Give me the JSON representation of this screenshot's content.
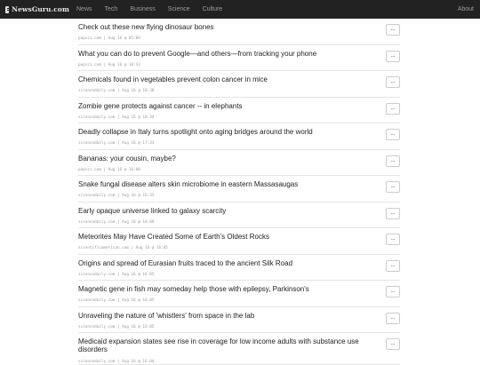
{
  "navbar": {
    "brand": "NewsGuru.com",
    "links": [
      "News",
      "Tech",
      "Business",
      "Science",
      "Culture"
    ],
    "about": "About"
  },
  "items": [
    {
      "title": "Check out these new flying dinosaur bones",
      "meta": "popsci.com | Aug 16 @ 05:06",
      "action": "..."
    },
    {
      "title": "What you can do to prevent Google—and others—from tracking your phone",
      "meta": "popsci.com | Aug 16 @ 18:43",
      "action": "..."
    },
    {
      "title": "Chemicals found in vegetables prevent colon cancer in mice",
      "meta": "sciencedaily.com | Aug 16 @ 18:38",
      "action": "..."
    },
    {
      "title": "Zombie gene protects against cancer -- in elephants",
      "meta": "sciencedaily.com | Aug 16 @ 18:34",
      "action": "..."
    },
    {
      "title": "Deadly collapse in Italy turns spotlight onto aging bridges around the world",
      "meta": "sciencedaily.com | Aug 16 @ 17:33",
      "action": "..."
    },
    {
      "title": "Bananas: your cousin, maybe?",
      "meta": "popsci.com | Aug 16 @ 16:08",
      "action": "..."
    },
    {
      "title": "Snake fungal disease alters skin microbiome in eastern Massasaugas",
      "meta": "sciencedaily.com | Aug 16 @ 16:33",
      "action": "..."
    },
    {
      "title": "Early opaque universe linked to galaxy scarcity",
      "meta": "sciencedaily.com | Aug 16 @ 16:09",
      "action": "..."
    },
    {
      "title": "Meteorites May Have Created Some of Earth's Oldest Rocks",
      "meta": "scientificamerican.com | Aug 16 @ 16:05",
      "action": "..."
    },
    {
      "title": "Origins and spread of Eurasian fruits traced to the ancient Silk Road",
      "meta": "sciencedaily.com | Aug 16 @ 16:05",
      "action": "..."
    },
    {
      "title": "Magnetic gene in fish may someday help those with epilepsy, Parkinson's",
      "meta": "sciencedaily.com | Aug 16 @ 16:05",
      "action": "..."
    },
    {
      "title": "Unraveling the nature of 'whistlers' from space in the lab",
      "meta": "sciencedaily.com | Aug 16 @ 16:05",
      "action": "..."
    },
    {
      "title": "Medicaid expansion states see rise in coverage for low income adults with substance use disorders",
      "meta": "sciencedaily.com | Aug 16 @ 16:04",
      "action": "..."
    }
  ]
}
